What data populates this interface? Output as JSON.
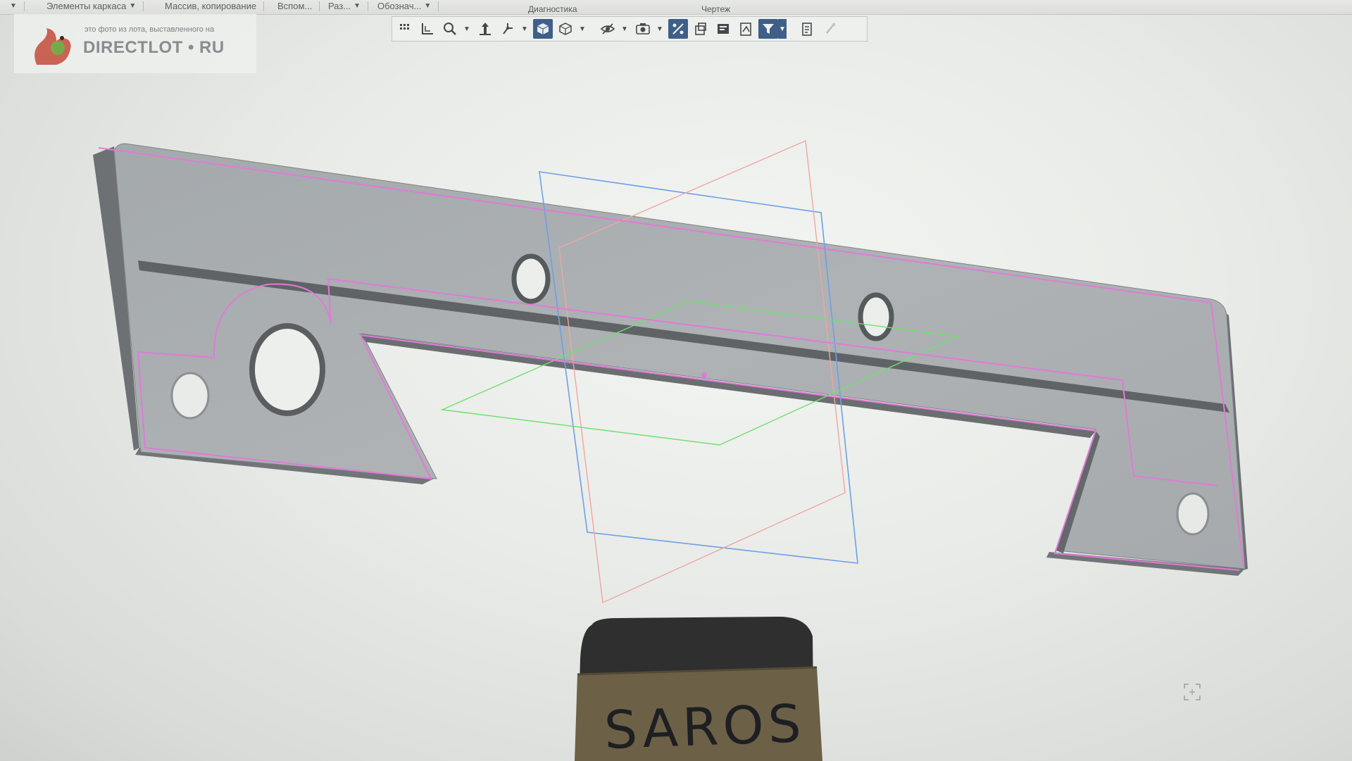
{
  "ribbon": {
    "groups": [
      {
        "label": "Элементы каркаса"
      },
      {
        "label": "Массив, копирование"
      },
      {
        "label": "Вспом..."
      },
      {
        "label": "Раз..."
      },
      {
        "label": "Обознач..."
      }
    ],
    "section_diagnostics": "Диагностика",
    "section_drawing": "Чертеж"
  },
  "toolbar": {
    "buttons": [
      {
        "icon": "grid-icon"
      },
      {
        "icon": "local-cs-icon"
      },
      {
        "icon": "zoom-icon"
      },
      {
        "icon": "move-icon"
      },
      {
        "icon": "orient-axis-icon"
      },
      {
        "icon": "shaded-view-icon",
        "active": true
      },
      {
        "icon": "wireframe-view-icon"
      },
      {
        "icon": "hide-icon"
      },
      {
        "icon": "view-camera-icon"
      },
      {
        "icon": "constraints-icon",
        "active": true
      },
      {
        "icon": "layers-icon"
      },
      {
        "icon": "section-icon"
      },
      {
        "icon": "drawing-icon"
      },
      {
        "icon": "filter-icon",
        "active": true
      },
      {
        "icon": "properties-icon"
      },
      {
        "icon": "pin-icon"
      }
    ]
  },
  "watermark": {
    "caption": "это фото из лота, выставленного на",
    "brand": "DIRECTLOT • RU"
  },
  "physical_label": {
    "text": "SAROS"
  },
  "colors": {
    "part_fill": "#a9aeb1",
    "edge_highlight": "#e07ad8",
    "plane_blue": "#6e9fe6",
    "plane_pink": "#ef9e9a",
    "plane_green": "#6fe06f",
    "toolbar_active": "#3f5f88"
  }
}
